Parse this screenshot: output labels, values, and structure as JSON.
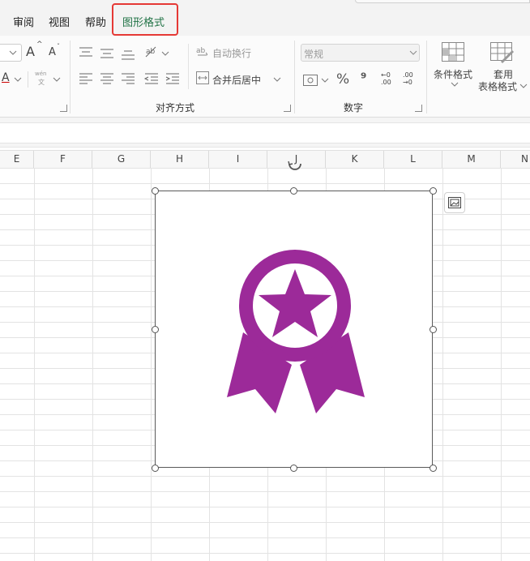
{
  "tabs": [
    {
      "label": "审阅"
    },
    {
      "label": "视图"
    },
    {
      "label": "帮助"
    },
    {
      "label": "图形格式"
    }
  ],
  "ribbon": {
    "font_grow": "A",
    "font_shrink": "A",
    "wrap_text_label": "自动换行",
    "merge_center_label": "合并后居中",
    "number_format_value": "常规",
    "percent_symbol": "%",
    "comma_symbol": "⁹",
    "decimal_up": "←0 .00",
    "decimal_down": ".00 →0",
    "conditional_format_label": "条件格式",
    "table_format_label_1": "套用",
    "table_format_label_2": "表格格式",
    "alignment_group_label": "对齐方式",
    "number_group_label": "数字",
    "pinyin_top": "wén",
    "pinyin_bottom": "文"
  },
  "columns": [
    "E",
    "F",
    "G",
    "H",
    "I",
    "J",
    "K",
    "L",
    "M",
    "N"
  ],
  "icons": {
    "award": "award-ribbon-icon",
    "quick_layout": "quick-layout-icon"
  },
  "colors": {
    "accent_tab": "#217346",
    "highlight": "#e53935",
    "award": "#9c2a99"
  }
}
